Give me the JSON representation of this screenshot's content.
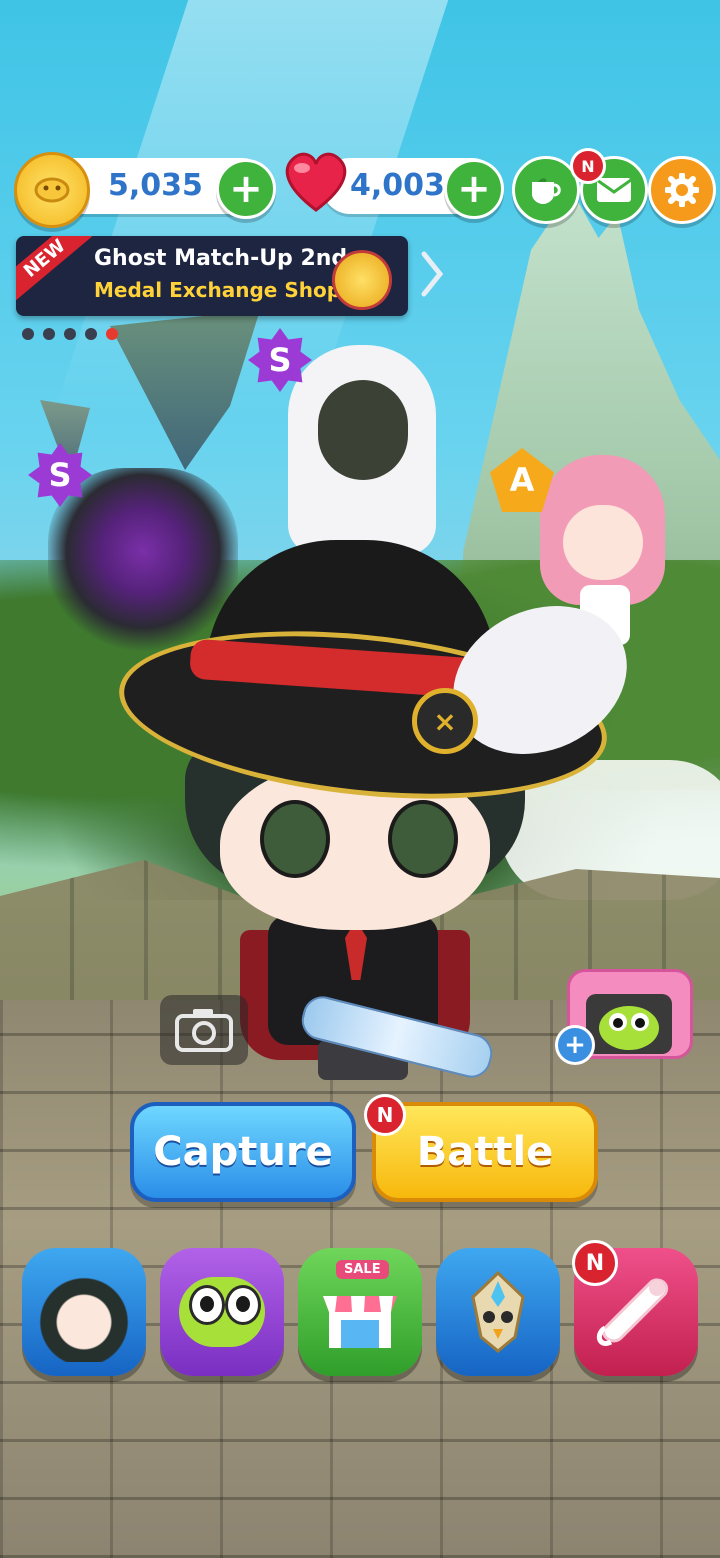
{
  "top_bar": {
    "coins": "5,035",
    "hearts": "4,003",
    "mail_badge": "N"
  },
  "banner": {
    "new_label": "NEW",
    "line1": "Ghost Match-Up 2nd",
    "line2": "Medal Exchange Shops",
    "page_dots": 5,
    "active_dot": 5
  },
  "grades": {
    "ghost": "S",
    "demon": "S",
    "bride": "A"
  },
  "actions": {
    "capture_label": "Capture",
    "battle_label": "Battle",
    "battle_badge": "N"
  },
  "bottom_nav": {
    "shop_sale_label": "SALE",
    "scroll_badge": "N"
  },
  "colors": {
    "capture": "#2a8ee8",
    "battle": "#f7b80c",
    "coin_plus": "#3fb33b",
    "settings": "#f59a1b"
  }
}
